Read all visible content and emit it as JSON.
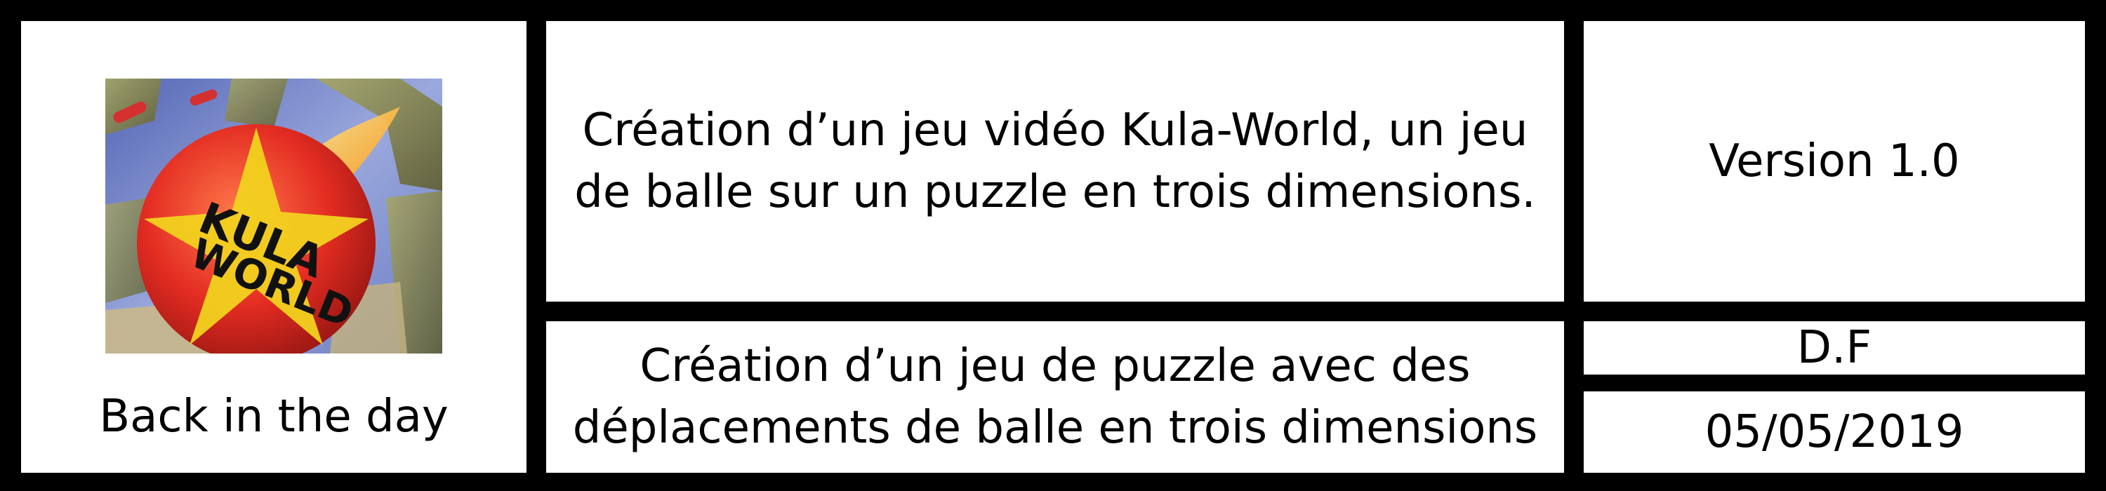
{
  "logo": {
    "caption": "Back in the day",
    "art_text_line1": "KULA",
    "art_text_line2": "WORLD",
    "colors": {
      "ball_red": "#e8352a",
      "ball_yellow": "#f2d21f",
      "sky_blue": "#7f8fd0",
      "block_olive": "#8a8a4a"
    }
  },
  "main": {
    "description": "Création d’un jeu vidéo Kula-World, un jeu de balle sur un puzzle en trois dimensions.",
    "subtitle": "Création d’un jeu de puzzle avec des déplacements de balle en trois dimensions"
  },
  "meta": {
    "version": "Version 1.0",
    "author": "D.F",
    "date": "05/05/2019"
  }
}
